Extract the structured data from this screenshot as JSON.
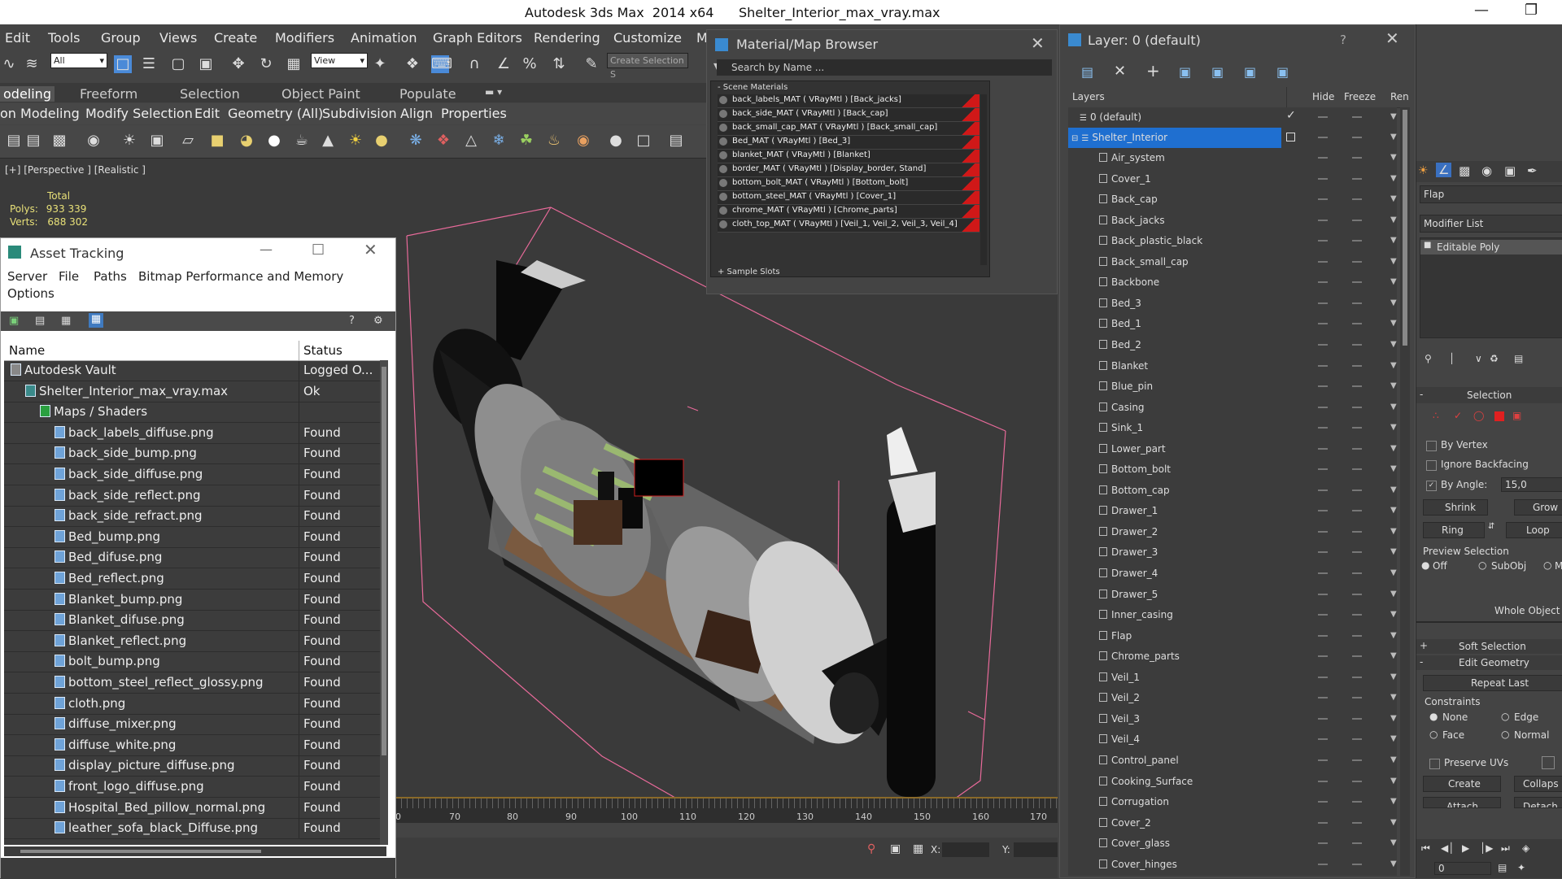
{
  "titlebar": {
    "title": "Autodesk 3ds Max  2014 x64      Shelter_Interior_max_vray.max"
  },
  "menubar": [
    "Edit",
    "Tools",
    "Group",
    "Views",
    "Create",
    "Modifiers",
    "Animation",
    "Graph Editors",
    "Rendering",
    "Customize",
    "M"
  ],
  "toolbar": {
    "filter_combo": "All",
    "view_combo": "View",
    "selection_set": "Create Selection S"
  },
  "ribbon": {
    "tabs": [
      "odeling",
      "Freeform",
      "Selection",
      "Object Paint",
      "Populate"
    ],
    "row2": [
      "on Modeling",
      "Modify Selection",
      "Edit",
      "Geometry (All)",
      "Subdivision",
      "Align",
      "Properties"
    ]
  },
  "viewport": {
    "label": "[+] [Perspective ] [Realistic ]",
    "stats_total": "Total",
    "polys_label": "Polys:",
    "polys_value": "933 339",
    "verts_label": "Verts:",
    "verts_value": "688 302"
  },
  "timeline": {
    "ticks": [
      "0",
      "70",
      "80",
      "90",
      "100",
      "110",
      "120",
      "130",
      "140",
      "150",
      "160",
      "170"
    ]
  },
  "status": {
    "x_label": "X:",
    "y_label": "Y:"
  },
  "asset_tracking": {
    "title": "Asset Tracking",
    "menu": [
      "Server",
      "File",
      "Paths",
      "Bitmap Performance and Memory",
      "Options"
    ],
    "col_name": "Name",
    "col_status": "Status",
    "rows": [
      {
        "name": "Autodesk Vault",
        "status": "Logged O...",
        "level": 0
      },
      {
        "name": "Shelter_Interior_max_vray.max",
        "status": "Ok",
        "level": 1
      },
      {
        "name": "Maps / Shaders",
        "status": "",
        "level": 2
      },
      {
        "name": "back_labels_diffuse.png",
        "status": "Found",
        "level": 3
      },
      {
        "name": "back_side_bump.png",
        "status": "Found",
        "level": 3
      },
      {
        "name": "back_side_diffuse.png",
        "status": "Found",
        "level": 3
      },
      {
        "name": "back_side_reflect.png",
        "status": "Found",
        "level": 3
      },
      {
        "name": "back_side_refract.png",
        "status": "Found",
        "level": 3
      },
      {
        "name": "Bed_bump.png",
        "status": "Found",
        "level": 3
      },
      {
        "name": "Bed_difuse.png",
        "status": "Found",
        "level": 3
      },
      {
        "name": "Bed_reflect.png",
        "status": "Found",
        "level": 3
      },
      {
        "name": "Blanket_bump.png",
        "status": "Found",
        "level": 3
      },
      {
        "name": "Blanket_difuse.png",
        "status": "Found",
        "level": 3
      },
      {
        "name": "Blanket_reflect.png",
        "status": "Found",
        "level": 3
      },
      {
        "name": "bolt_bump.png",
        "status": "Found",
        "level": 3
      },
      {
        "name": "bottom_steel_reflect_glossy.png",
        "status": "Found",
        "level": 3
      },
      {
        "name": "cloth.png",
        "status": "Found",
        "level": 3
      },
      {
        "name": "diffuse_mixer.png",
        "status": "Found",
        "level": 3
      },
      {
        "name": "diffuse_white.png",
        "status": "Found",
        "level": 3
      },
      {
        "name": "display_picture_diffuse.png",
        "status": "Found",
        "level": 3
      },
      {
        "name": "front_logo_diffuse.png",
        "status": "Found",
        "level": 3
      },
      {
        "name": "Hospital_Bed_pillow_normal.png",
        "status": "Found",
        "level": 3
      },
      {
        "name": "leather_sofa_black_Diffuse.png",
        "status": "Found",
        "level": 3
      }
    ]
  },
  "material_browser": {
    "title": "Material/Map Browser",
    "search_placeholder": "Search by Name ...",
    "section_scene": "- Scene Materials",
    "section_slots": "+ Sample Slots",
    "materials": [
      "back_labels_MAT ( VRayMtl ) [Back_jacks]",
      "back_side_MAT ( VRayMtl ) [Back_cap]",
      "back_small_cap_MAT ( VRayMtl ) [Back_small_cap]",
      "Bed_MAT ( VRayMtl ) [Bed_3]",
      "blanket_MAT ( VRayMtl ) [Blanket]",
      "border_MAT ( VRayMtl ) [Display_border, Stand]",
      "bottom_bolt_MAT ( VRayMtl ) [Bottom_bolt]",
      "bottom_steel_MAT ( VRayMtl ) [Cover_1]",
      "chrome_MAT ( VRayMtl ) [Chrome_parts]",
      "cloth_top_MAT ( VRayMtl ) [Veil_1, Veil_2, Veil_3, Veil_4]"
    ]
  },
  "layer_dialog": {
    "title": "Layer: 0 (default)",
    "help": "?",
    "col_layers": "Layers",
    "col_hide": "Hide",
    "col_freeze": "Freeze",
    "col_render": "Ren",
    "default_layer": "0 (default)",
    "selected_layer": "Shelter_Interior",
    "objects": [
      "Air_system",
      "Cover_1",
      "Back_cap",
      "Back_jacks",
      "Back_plastic_black",
      "Back_small_cap",
      "Backbone",
      "Bed_3",
      "Bed_1",
      "Bed_2",
      "Blanket",
      "Blue_pin",
      "Casing",
      "Sink_1",
      "Lower_part",
      "Bottom_bolt",
      "Bottom_cap",
      "Drawer_1",
      "Drawer_2",
      "Drawer_3",
      "Drawer_4",
      "Drawer_5",
      "Inner_casing",
      "Flap",
      "Chrome_parts",
      "Veil_1",
      "Veil_2",
      "Veil_3",
      "Veil_4",
      "Control_panel",
      "Cooking_Surface",
      "Corrugation",
      "Cover_2",
      "Cover_glass",
      "Cover_hinges"
    ]
  },
  "command_panel": {
    "object_name": "Flap",
    "modifier_list": "Modifier List",
    "stack_item": "Editable Poly",
    "selection_rollout": "Selection",
    "by_vertex": "By Vertex",
    "ignore_backfacing": "Ignore Backfacing",
    "by_angle": "By Angle:",
    "by_angle_value": "15,0",
    "shrink": "Shrink",
    "grow": "Grow",
    "ring": "Ring",
    "loop": "Loop",
    "preview_selection": "Preview Selection",
    "off": "Off",
    "subobj": "SubObj",
    "multi": "M",
    "whole_object": "Whole Object Se",
    "soft_selection": "Soft Selection",
    "edit_geometry": "Edit Geometry",
    "repeat_last": "Repeat Last",
    "constraints": "Constraints",
    "none": "None",
    "edge": "Edge",
    "face": "Face",
    "normal": "Normal",
    "preserve_uvs": "Preserve UVs",
    "create": "Create",
    "collapse": "Collaps",
    "attach": "Attach",
    "detach": "Detach",
    "frame_value": "0"
  },
  "colors": {
    "accent_blue": "#1f6fd0",
    "material_red": "#d01818",
    "stats_yellow": "#e8e078"
  }
}
